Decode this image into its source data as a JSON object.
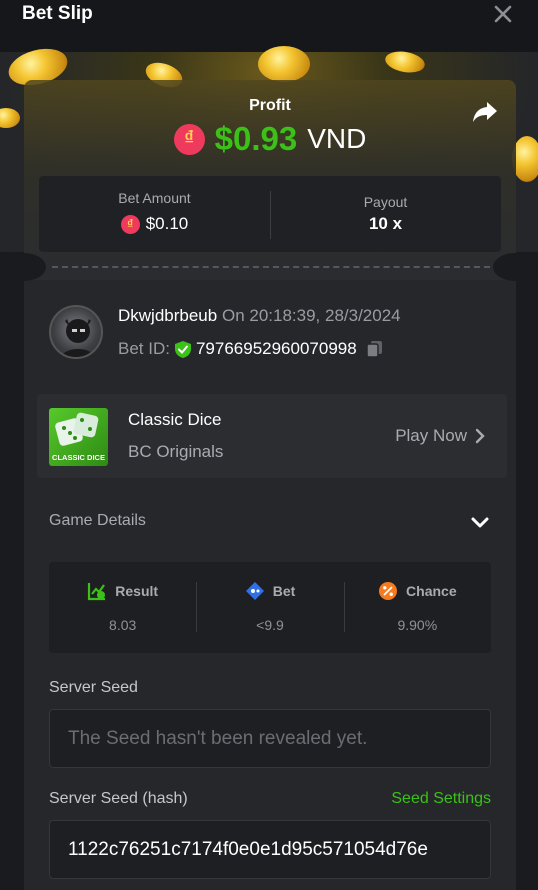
{
  "header": {
    "title": "Bet Slip"
  },
  "profit": {
    "label": "Profit",
    "currency_symbol": "₫",
    "amount": "$0.93",
    "currency": "VND"
  },
  "stats": {
    "bet_amount_label": "Bet Amount",
    "bet_amount_value": "$0.10",
    "payout_label": "Payout",
    "payout_value": "10 x"
  },
  "user": {
    "name": "Dkwjdbrbeub",
    "time": "On 20:18:39, 28/3/2024",
    "bet_id_label": "Bet ID:",
    "bet_id": "79766952960070998"
  },
  "game": {
    "name": "Classic Dice",
    "provider": "BC Originals",
    "thumb_text": "CLASSIC DICE",
    "play_label": "Play Now"
  },
  "details": {
    "heading": "Game Details",
    "cells": [
      {
        "label": "Result",
        "value": "8.03",
        "icon": "chart-check-icon",
        "color": "#3bc117"
      },
      {
        "label": "Bet",
        "value": "<9.9",
        "icon": "tag-icon",
        "color": "#2f6fe8"
      },
      {
        "label": "Chance",
        "value": "9.90%",
        "icon": "percent-icon",
        "color": "#f47b20"
      }
    ]
  },
  "seed": {
    "server_seed_label": "Server Seed",
    "server_seed_value": "The Seed hasn't been revealed yet.",
    "hash_label": "Server Seed (hash)",
    "seed_settings_label": "Seed Settings",
    "hash_value": "1122c76251c7174f0e0e1d95c571054d76e"
  },
  "colors": {
    "accent_green": "#3bc117",
    "brand_red": "#ef3a5d"
  }
}
